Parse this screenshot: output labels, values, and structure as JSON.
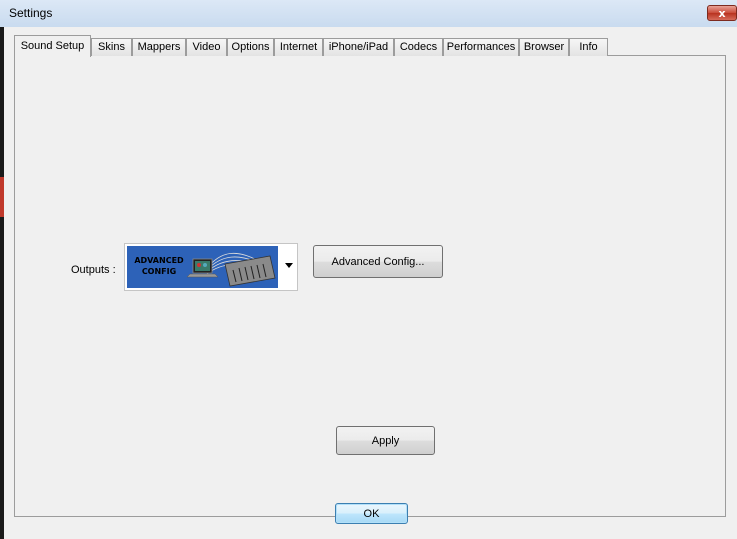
{
  "window": {
    "title": "Settings",
    "close_glyph": "x"
  },
  "tabs": [
    {
      "label": "Sound Setup",
      "active": true
    },
    {
      "label": "Skins"
    },
    {
      "label": "Mappers"
    },
    {
      "label": "Video"
    },
    {
      "label": "Options"
    },
    {
      "label": "Internet"
    },
    {
      "label": "iPhone/iPad"
    },
    {
      "label": "Codecs"
    },
    {
      "label": "Performances"
    },
    {
      "label": "Browser"
    },
    {
      "label": "Info"
    }
  ],
  "sound_setup": {
    "outputs_label": "Outputs :",
    "outputs_selected": {
      "line1": "ADVANCED",
      "line2": "CONFIG"
    },
    "advanced_config_button": "Advanced Config...",
    "apply_button": "Apply"
  },
  "footer": {
    "ok_button": "OK"
  },
  "colors": {
    "image_background": "#2d62b8",
    "close_button": "#c94a38"
  }
}
